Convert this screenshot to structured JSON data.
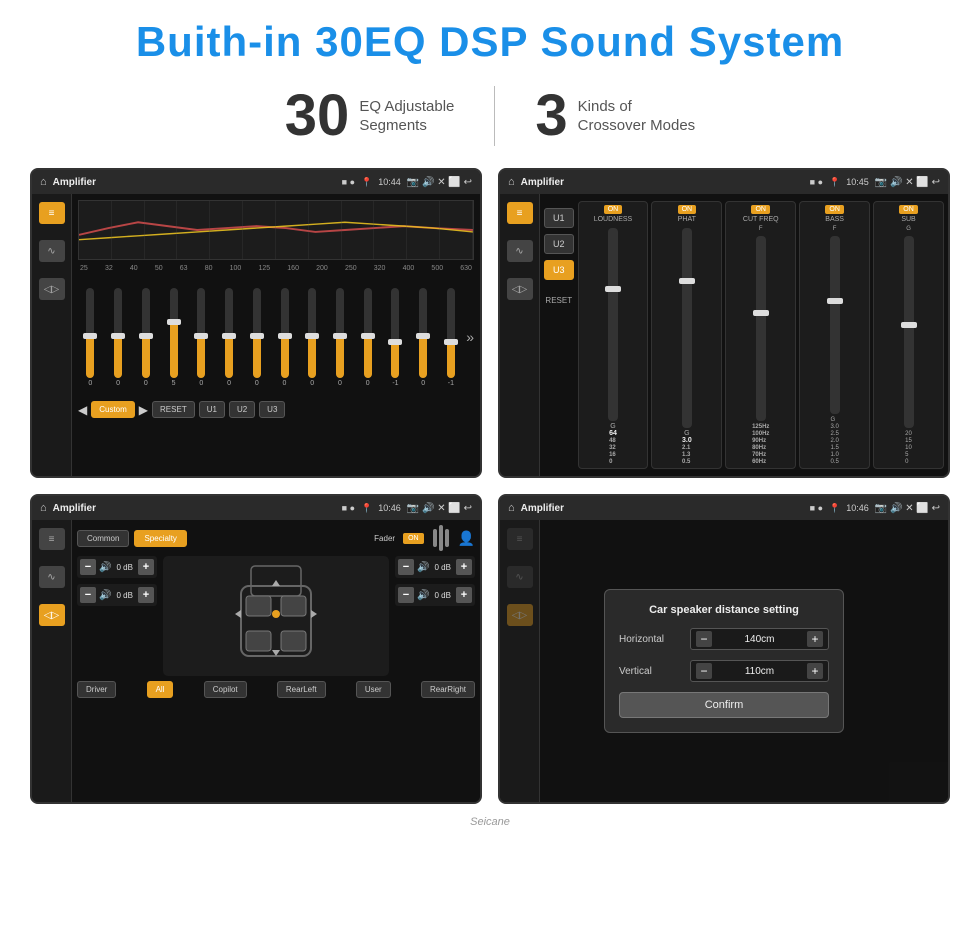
{
  "header": {
    "title": "Buith-in 30EQ DSP Sound System"
  },
  "stats": {
    "eq_number": "30",
    "eq_label": "EQ Adjustable\nSegments",
    "crossover_number": "3",
    "crossover_label": "Kinds of\nCrossover Modes"
  },
  "screen1": {
    "title": "Amplifier",
    "time": "10:44",
    "freq_labels": [
      "25",
      "32",
      "40",
      "50",
      "63",
      "80",
      "100",
      "125",
      "160",
      "200",
      "250",
      "320",
      "400",
      "500",
      "630"
    ],
    "sliders": [
      0,
      0,
      0,
      5,
      0,
      0,
      0,
      0,
      0,
      0,
      0,
      -1,
      0,
      -1
    ],
    "bottom_btns": [
      "Custom",
      "RESET",
      "U1",
      "U2",
      "U3"
    ],
    "mode_label": "Custom"
  },
  "screen2": {
    "title": "Amplifier",
    "time": "10:45",
    "u_btns": [
      "U1",
      "U2",
      "U3"
    ],
    "active_u": "U3",
    "panels": [
      {
        "on": true,
        "label": "LOUDNESS"
      },
      {
        "on": true,
        "label": "PHAT"
      },
      {
        "on": true,
        "label": "CUT FREQ"
      },
      {
        "on": true,
        "label": "BASS"
      },
      {
        "on": true,
        "label": "SUB"
      }
    ],
    "reset_label": "RESET"
  },
  "screen3": {
    "title": "Amplifier",
    "time": "10:46",
    "mode_btns": [
      "Common",
      "Specialty"
    ],
    "fader_label": "Fader",
    "fader_on": "ON",
    "vol_rows": [
      {
        "label": "0 dB"
      },
      {
        "label": "0 dB"
      },
      {
        "label": "0 dB"
      },
      {
        "label": "0 dB"
      }
    ],
    "bottom_btns": [
      {
        "label": "Driver",
        "active": false
      },
      {
        "label": "RearLeft",
        "active": false
      },
      {
        "label": "All",
        "active": true
      },
      {
        "label": "User",
        "active": false
      },
      {
        "label": "Copilot",
        "active": false
      },
      {
        "label": "RearRight",
        "active": false
      }
    ]
  },
  "screen4": {
    "title": "Amplifier",
    "time": "10:46",
    "dialog": {
      "title": "Car speaker distance setting",
      "horizontal_label": "Horizontal",
      "horizontal_value": "140cm",
      "vertical_label": "Vertical",
      "vertical_value": "110cm",
      "confirm_label": "Confirm"
    }
  },
  "watermark": "Seicane"
}
